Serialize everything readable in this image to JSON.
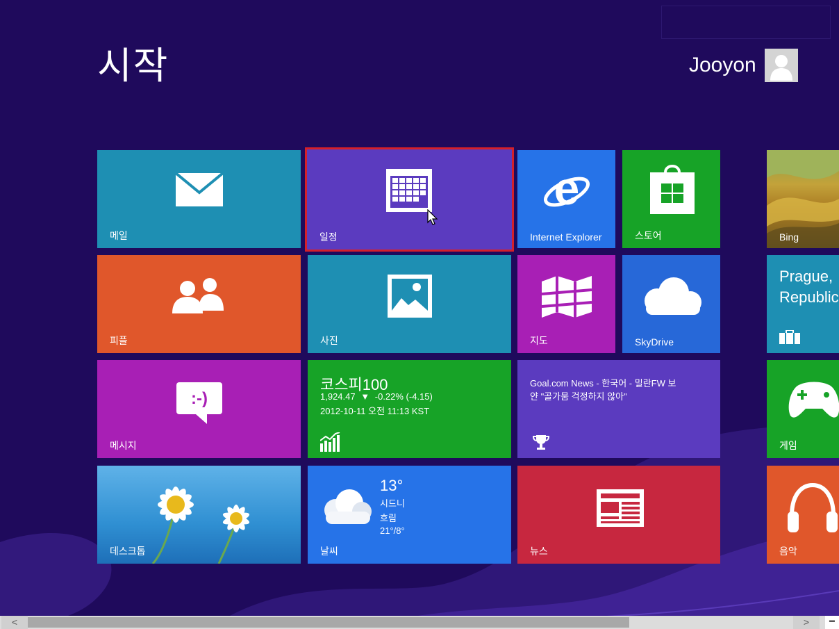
{
  "header": {
    "title": "시작",
    "user_name": "Jooyon"
  },
  "tiles": {
    "mail": "메일",
    "calendar": "일정",
    "ie": "Internet Explorer",
    "store": "스토어",
    "bing": "Bing",
    "people": "피플",
    "photos": "사진",
    "maps": "지도",
    "skydrive": "SkyDrive",
    "travel": {
      "line1": "Prague,",
      "line2": "Republic"
    },
    "messaging": "메시지",
    "finance": {
      "title": "코스피100",
      "value": "1,924.47",
      "change": "-0.22% (-4.15)",
      "arrow": "▼",
      "timestamp": "2012-10-11 오전 11:13 KST"
    },
    "sports": {
      "line1": "Goal.com News - 한국어 - 밀란FW 보",
      "line2": "얀 \"골가뭄 걱정하지 않아\""
    },
    "games": "게임",
    "desktop": "데스크톱",
    "weather": {
      "label": "날씨",
      "temp": "13°",
      "city": "시드니",
      "condition": "흐림",
      "range": "21°/8°"
    },
    "news": "뉴스",
    "music": "음악"
  },
  "colors": {
    "background": "#1f0a5c",
    "selection": "#d4202a",
    "mail": "#1e8fb3",
    "calendar": "#5b3bbf",
    "ie": "#2673e8",
    "store": "#17a327",
    "people": "#e0572b",
    "photos": "#1e8fb3",
    "maps": "#a81fb5",
    "skydrive": "#2768d8",
    "messaging": "#a81fb5",
    "finance": "#17a327",
    "sports": "#5b3bbf",
    "weather": "#2673e8",
    "news": "#c7273f",
    "music": "#e0572b",
    "games": "#17a327",
    "travel": "#1e8fb3"
  },
  "scrollbar": {
    "left": "<",
    "right": ">",
    "minus": "−"
  },
  "icons": [
    "mail-icon",
    "calendar-icon",
    "ie-icon",
    "store-icon",
    "people-icon",
    "photo-icon",
    "maps-icon",
    "cloud-icon",
    "suitcase-icon",
    "message-icon",
    "chart-icon",
    "trophy-icon",
    "gamepad-icon",
    "weather-cloud-icon",
    "newspaper-icon",
    "headphones-icon",
    "avatar-icon"
  ]
}
